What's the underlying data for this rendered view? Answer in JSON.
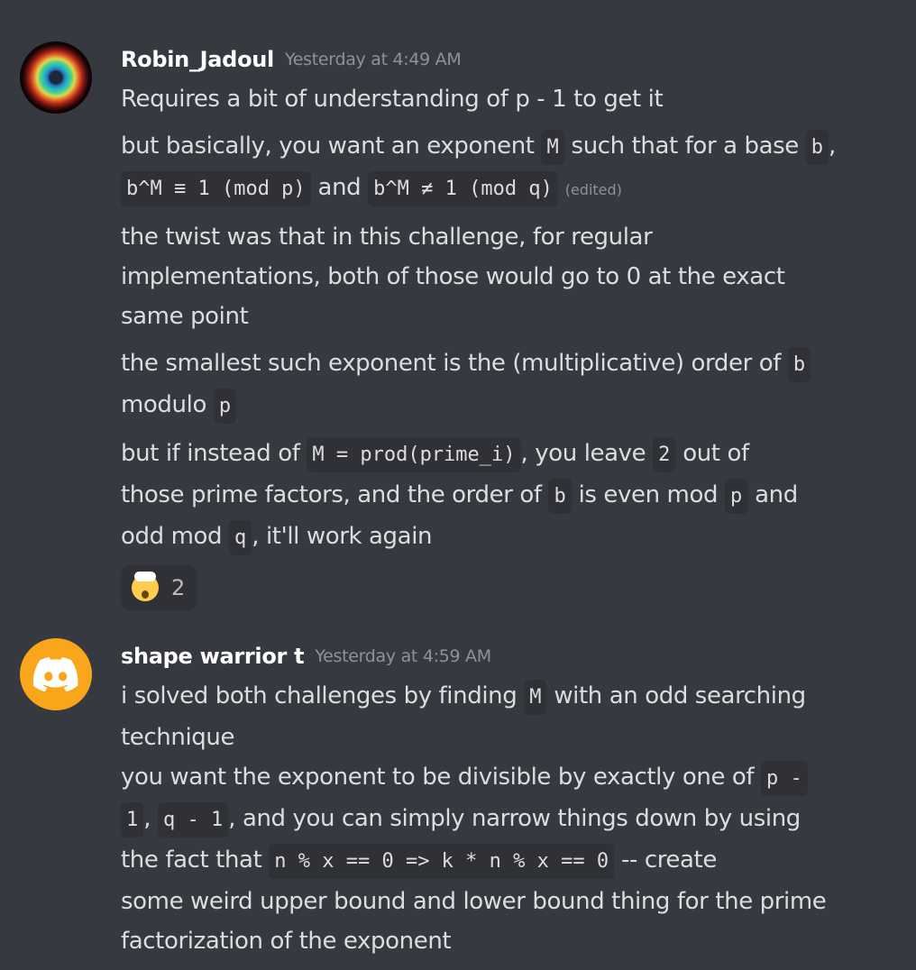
{
  "messages": [
    {
      "username": "Robin_Jadoul",
      "timestamp": "Yesterday at 4:49 AM",
      "avatar_icon": "nebula-avatar",
      "lines": {
        "l1": "Requires a bit of understanding of p - 1 to get it",
        "l2a": "but basically, you want an exponent ",
        "l2b": "M",
        "l2c": " such that for a base ",
        "l2d": "b",
        "l2e": ",",
        "l3a": "b^M ≡ 1 (mod p)",
        "l3b": " and ",
        "l3c": "b^M ≠ 1 (mod q)",
        "l3edited": "(edited)",
        "l4": "the twist was that in this challenge, for regular",
        "l5": "implementations, both of those would go to 0 at the exact",
        "l6": "same point",
        "l7a": "the smallest such exponent is the (multiplicative) order of ",
        "l7b": "b",
        "l8a": "modulo ",
        "l8b": "p",
        "l9a": "but if instead of ",
        "l9b": "M = prod(prime_i)",
        "l9c": ", you leave ",
        "l9d": "2",
        "l9e": " out of",
        "l10a": "those prime factors, and the order of ",
        "l10b": "b",
        "l10c": " is even mod ",
        "l10d": "p",
        "l10e": " and",
        "l11a": "odd mod ",
        "l11b": "q",
        "l11c": ", it'll work again"
      },
      "reaction": {
        "emoji_icon": "exploding-head-icon",
        "count": "2"
      }
    },
    {
      "username": "shape warrior t",
      "timestamp": "Yesterday at 4:59 AM",
      "avatar_icon": "discord-logo-avatar",
      "avatar_color": "#faa61a",
      "lines": {
        "l1a": "i solved both challenges by finding ",
        "l1b": "M",
        "l1c": " with an odd searching",
        "l2": "technique",
        "l3a": "you want the exponent to be divisible by exactly one of ",
        "l3b": "p -",
        "l4a": "1",
        "l4b": ", ",
        "l4c": "q - 1",
        "l4d": ", and you can simply narrow things down by using",
        "l5a": "the fact that ",
        "l5b": "n % x == 0 => k * n % x == 0",
        "l5c": " -- create",
        "l6": "some weird upper bound and lower bound thing for the prime",
        "l7": "factorization of the exponent"
      }
    }
  ]
}
